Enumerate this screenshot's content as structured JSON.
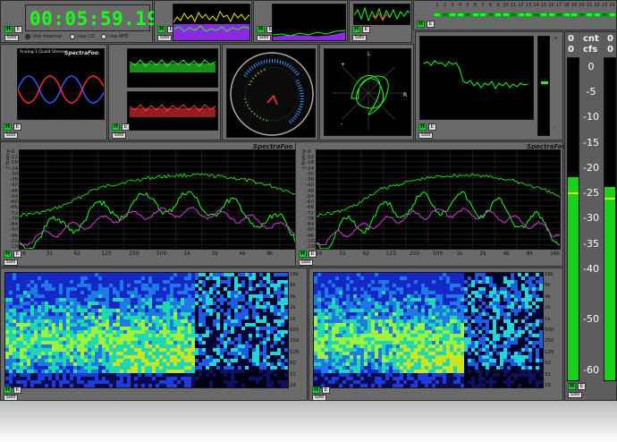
{
  "clock": {
    "time": "00:05:59.19"
  },
  "transport": {
    "solo_label": "Solo",
    "radios": [
      {
        "label": "Use Internal",
        "selected": true
      },
      {
        "label": "Use CD",
        "selected": false
      },
      {
        "label": "Use MTC",
        "selected": false
      }
    ]
  },
  "brand": "SpectraFoo",
  "small_scope_label": "Analog 1 Qualit Stereo",
  "scope_labels": {
    "L": "L",
    "R": "R",
    "plus": "+",
    "minus": "-"
  },
  "channel_numbers": [
    "1",
    "2",
    "3",
    "4",
    "5",
    "6",
    "7",
    "8",
    "9",
    "10",
    "11",
    "12",
    "13",
    "14",
    "15",
    "16",
    "17",
    "18",
    "19",
    "20",
    "21",
    "22",
    "23",
    "24"
  ],
  "analyzer_freq_ticks": [
    "16",
    "31",
    "62",
    "125",
    "250",
    "500",
    "1k",
    "2k",
    "4k",
    "8k",
    "16k"
  ],
  "analyzer_db_ticks": [
    "-6",
    "-12",
    "-18",
    "-24",
    "-30",
    "-36",
    "-42",
    "-48",
    "-54",
    "-60",
    "-66",
    "-72",
    "-78",
    "-84",
    "-90",
    "-96",
    "-102",
    "-108"
  ],
  "analyzer_side_labels": {
    "left": "Analog 2",
    "right": "Analog 1"
  },
  "spectrogram_freq_ticks": [
    "16k",
    "8k",
    "4k",
    "2k",
    "1k",
    "500",
    "250",
    "125",
    "62",
    "31",
    "16"
  ],
  "meter": {
    "header_left": "cnt",
    "header_right": "cfs",
    "peak_left": "0",
    "peak_right": "0",
    "peak_left2": "0",
    "peak_right2": "0",
    "scale": [
      "0",
      "-5",
      "-10",
      "-15",
      "-20",
      "-25",
      "-30",
      "-35",
      "-40",
      "-50",
      "-60"
    ],
    "level_left": 0.63,
    "level_right": 0.6
  },
  "colors": {
    "accent_green": "#1bff1b",
    "panel": "#6a6a6a",
    "screen": "#000000",
    "trace_magenta": "#d23cd2",
    "trace_yellow": "#e6e61b"
  }
}
